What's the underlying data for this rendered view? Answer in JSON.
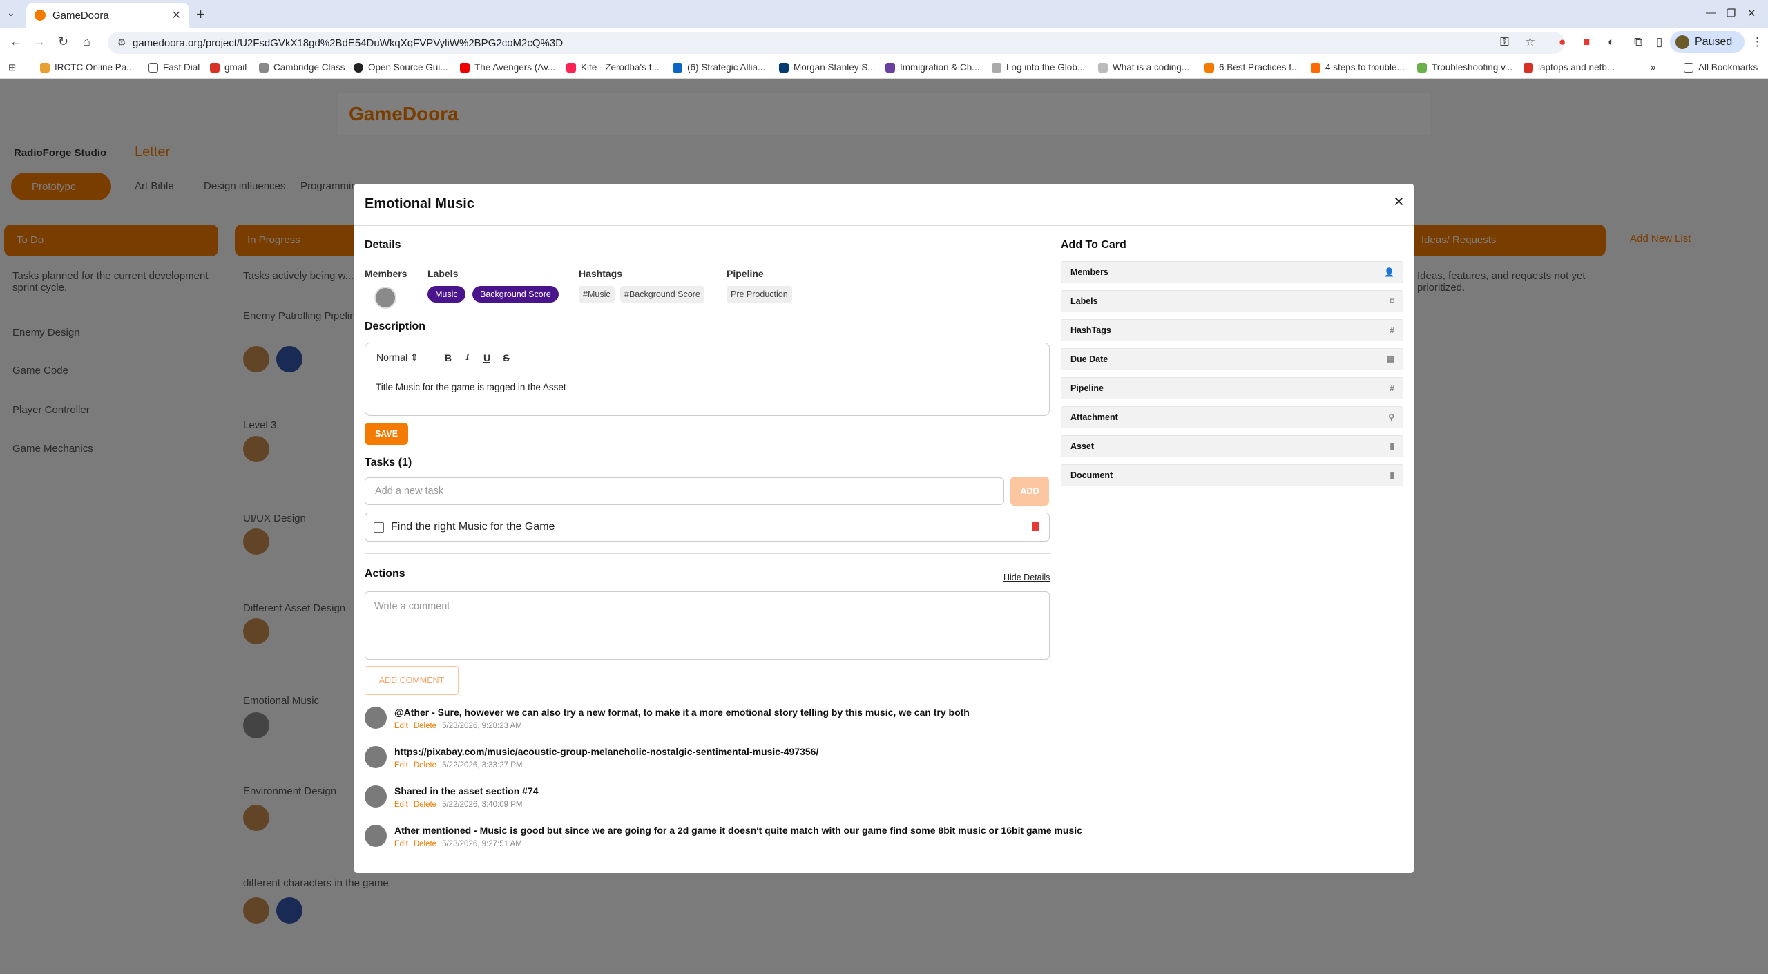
{
  "browser": {
    "tab_title": "GameDoora",
    "url": "gamedoora.org/project/U2FsdGVkX18gd%2BdE54DuWkqXqFVPVyliW%2BPG2coM2cQ%3D",
    "paused_label": "Paused",
    "bookmarks": [
      "IRCTC Online Pa...",
      "Fast Dial",
      "gmail",
      "Cambridge Class",
      "Open Source Gui...",
      "The Avengers (Av...",
      "Kite - Zerodha's f...",
      "(6) Strategic Allia...",
      "Morgan Stanley S...",
      "Immigration & Ch...",
      "Log into the Glob...",
      "What is a coding...",
      "6 Best Practices f...",
      "4 steps to trouble...",
      "Troubleshooting v...",
      "laptops and netb..."
    ],
    "all_bookmarks": "All Bookmarks"
  },
  "background": {
    "logo": "GameDoora",
    "breadcrumb_studio": "RadioForge Studio",
    "breadcrumb_project": "Letter",
    "tabs": [
      "Prototype",
      "Art Bible",
      "Design influences",
      "Programming"
    ],
    "columns": [
      "To Do",
      "In Progress",
      "Ideas/ Requests"
    ],
    "col1_desc": "Tasks planned for the current development sprint cycle.",
    "col1_items": [
      "Enemy Design",
      "Game Code",
      "Player Controller",
      "Game Mechanics"
    ],
    "col2_desc": "Tasks actively being w...",
    "col2_items": [
      "Enemy Patrolling Pipeline",
      "Level 3",
      "UI/UX Design",
      "Different Asset Design",
      "Emotional Music",
      "Environment Design",
      "different characters in the game"
    ],
    "col3_desc": "Ideas, features, and requests not yet prioritized.",
    "add_list": "Add New List"
  },
  "modal": {
    "title": "Emotional Music",
    "details_heading": "Details",
    "members_label": "Members",
    "labels_label": "Labels",
    "hashtags_label": "Hashtags",
    "pipeline_label": "Pipeline",
    "labels": [
      "Music",
      "Background Score"
    ],
    "hashtags": [
      "#Music",
      "#Background Score"
    ],
    "pipeline": "Pre Production",
    "description_heading": "Description",
    "editor_format": "Normal",
    "description_text": "Title Music for the game is tagged in the Asset",
    "save_label": "SAVE",
    "tasks_heading": "Tasks (1)",
    "task_placeholder": "Add a new task",
    "add_label": "ADD",
    "tasks": [
      "Find the right Music for the Game"
    ],
    "actions_heading": "Actions",
    "hide_details": "Hide Details",
    "comment_placeholder": "Write a comment",
    "add_comment_label": "ADD COMMENT",
    "edit_label": "Edit",
    "delete_label": "Delete",
    "comments": [
      {
        "text": "@Ather - Sure, however we can also try a new format, to make it a more emotional story telling by this music, we can try both",
        "time": "5/23/2026, 9:28:23 AM"
      },
      {
        "text": "https://pixabay.com/music/acoustic-group-melancholic-nostalgic-sentimental-music-497356/",
        "time": "5/22/2026, 3:33:27 PM"
      },
      {
        "text": "Shared in the asset section #74",
        "time": "5/22/2026, 3:40:09 PM"
      },
      {
        "text": "Ather mentioned - Music is good but since we are going for a 2d game it doesn't quite match with our game find some 8bit music or 16bit game music",
        "time": "5/23/2026, 9:27:51 AM"
      }
    ],
    "add_to_card_heading": "Add To Card",
    "add_to_card": [
      "Members",
      "Labels",
      "HashTags",
      "Due Date",
      "Pipeline",
      "Attachment",
      "Asset",
      "Document"
    ]
  },
  "colors": {
    "accent": "#f47b00",
    "label_purple": "#4a148c",
    "delete_red": "#e53935"
  }
}
